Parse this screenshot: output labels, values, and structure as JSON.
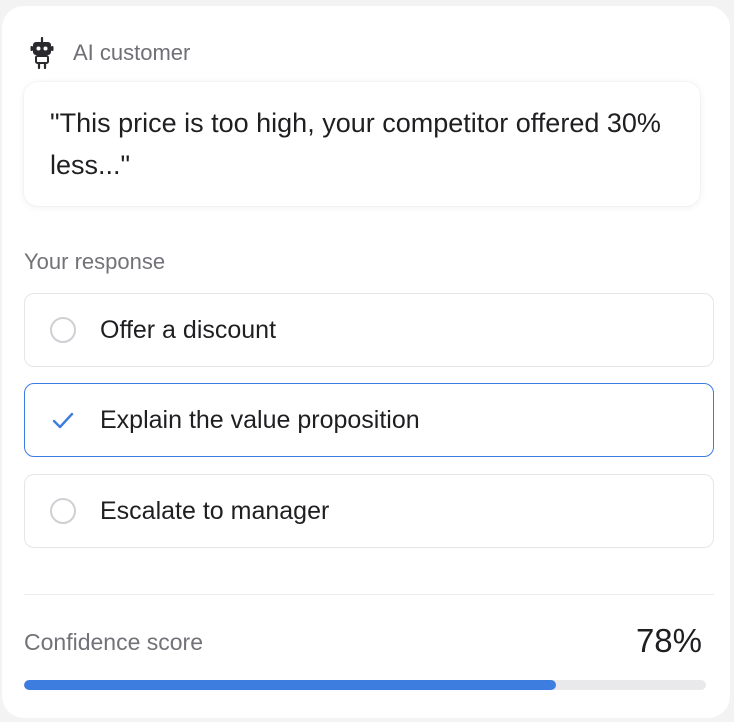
{
  "customer": {
    "icon": "robot-icon",
    "label": "AI customer",
    "message": "\"This price is too high, your competitor offered 30% less...\""
  },
  "response": {
    "section_label": "Your response",
    "options": [
      {
        "label": "Offer a discount",
        "selected": false
      },
      {
        "label": "Explain the value proposition",
        "selected": true
      },
      {
        "label": "Escalate to manager",
        "selected": false
      }
    ]
  },
  "confidence": {
    "label": "Confidence score",
    "value_text": "78%",
    "fill_fraction": 0.78
  },
  "colors": {
    "accent": "#3d7de0",
    "track": "#e9e9ec",
    "muted_text": "#727278"
  }
}
